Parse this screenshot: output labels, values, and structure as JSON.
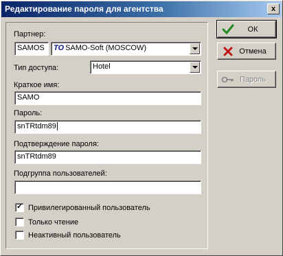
{
  "window": {
    "title": "Редактирование пароля для агентства",
    "close_glyph": "x"
  },
  "form": {
    "partner_label": "Партнер:",
    "partner_code": "SAMOS",
    "partner_logo": "TO",
    "partner_name": "SAMO-Soft (MOSCOW)",
    "access_type_label": "Тип доступа:",
    "access_type_value": "Hotel",
    "short_name_label": "Краткое имя:",
    "short_name_value": "SAMO",
    "password_label": "Пароль:",
    "password_value": "snTRtdm89",
    "confirm_label": "Подтверждение пароля:",
    "confirm_value": "snTRtdm89",
    "subgroup_label": "Подгруппа пользователей:",
    "subgroup_value": ""
  },
  "checkboxes": [
    {
      "label": "Привилегированный пользователь",
      "checked": true
    },
    {
      "label": "Только чтение",
      "checked": false
    },
    {
      "label": "Неактивный пользователь",
      "checked": false
    }
  ],
  "buttons": {
    "ok": "ОК",
    "cancel": "Отмена",
    "password": "Пароль"
  },
  "colors": {
    "ok_icon": "#1f8a1f",
    "cancel_icon": "#c01818",
    "titlebar": "#0a246a"
  },
  "icons": {
    "ok": "checkmark-icon",
    "cancel": "x-icon",
    "password": "key-icon"
  }
}
